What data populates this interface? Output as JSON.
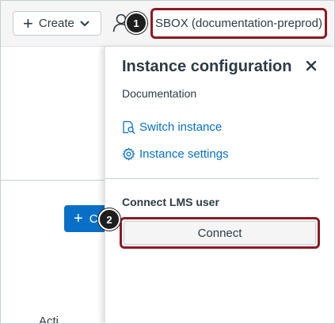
{
  "topbar": {
    "create_label": "Create",
    "instance_label": "SBOX (documentation-preprod)"
  },
  "callouts": [
    "1",
    "2"
  ],
  "panel": {
    "title": "Instance configuration",
    "subtitle": "Documentation",
    "links": [
      {
        "label": "Switch instance",
        "icon": "search-document-icon"
      },
      {
        "label": "Instance settings",
        "icon": "gear-icon"
      }
    ],
    "section_title": "Connect LMS user",
    "connect_label": "Connect"
  },
  "colors": {
    "link": "#0770c6",
    "highlight": "#8b1a24",
    "primary_button": "#0770c6",
    "text": "#2d3b45"
  }
}
